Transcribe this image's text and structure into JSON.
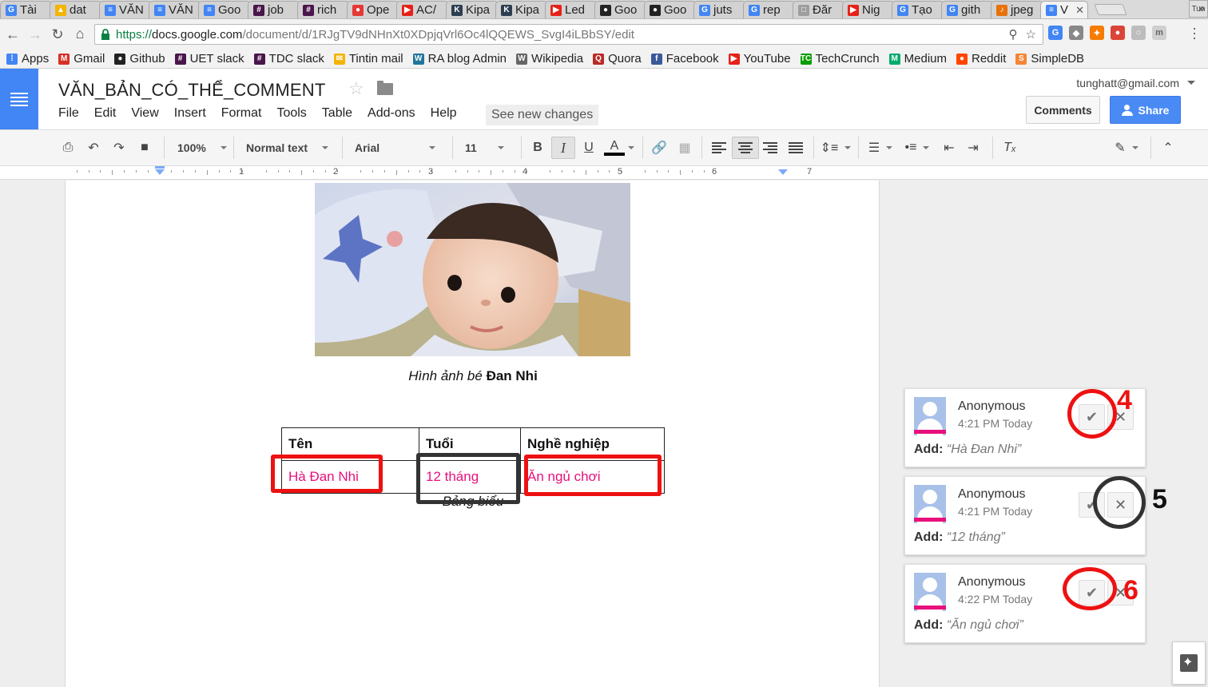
{
  "browser": {
    "tabs": [
      {
        "label": "Tài",
        "icon": "google-icon",
        "color": "#4285f4",
        "glyph": "G"
      },
      {
        "label": "dat",
        "icon": "drive-icon",
        "color": "#f4b400",
        "glyph": "▲"
      },
      {
        "label": "VĂN",
        "icon": "docs-icon",
        "color": "#4285f4",
        "glyph": "≡"
      },
      {
        "label": "VĂN",
        "icon": "docs-icon",
        "color": "#4285f4",
        "glyph": "≡"
      },
      {
        "label": "Goo",
        "icon": "docs-icon",
        "color": "#4285f4",
        "glyph": "≡"
      },
      {
        "label": "job",
        "icon": "slack-icon",
        "color": "#4a154b",
        "glyph": "#"
      },
      {
        "label": "rich",
        "icon": "slack-icon",
        "color": "#4a154b",
        "glyph": "#"
      },
      {
        "label": "Ope",
        "icon": "pokeball-icon",
        "color": "#e53935",
        "glyph": "●"
      },
      {
        "label": "AC/",
        "icon": "youtube-icon",
        "color": "#e62117",
        "glyph": "▶"
      },
      {
        "label": "Kipa",
        "icon": "kipalog-icon",
        "color": "#2c3e50",
        "glyph": "K"
      },
      {
        "label": "Kipa",
        "icon": "kipalog-icon",
        "color": "#2c3e50",
        "glyph": "K"
      },
      {
        "label": "Led",
        "icon": "youtube-icon",
        "color": "#e62117",
        "glyph": "▶"
      },
      {
        "label": "Goo",
        "icon": "github-icon",
        "color": "#222222",
        "glyph": "●"
      },
      {
        "label": "Goo",
        "icon": "github-icon",
        "color": "#222222",
        "glyph": "●"
      },
      {
        "label": "juts",
        "icon": "google-icon",
        "color": "#4285f4",
        "glyph": "G"
      },
      {
        "label": "rep",
        "icon": "google-icon",
        "color": "#4285f4",
        "glyph": "G"
      },
      {
        "label": "Đăr",
        "icon": "page-icon",
        "color": "#9e9e9e",
        "glyph": "□"
      },
      {
        "label": "Nig",
        "icon": "youtube-icon",
        "color": "#e62117",
        "glyph": "▶"
      },
      {
        "label": "Tạo",
        "icon": "google-icon",
        "color": "#4285f4",
        "glyph": "G"
      },
      {
        "label": "gith",
        "icon": "google-icon",
        "color": "#4285f4",
        "glyph": "G"
      },
      {
        "label": "jpeg",
        "icon": "extension-icon",
        "color": "#e8710a",
        "glyph": "♪"
      },
      {
        "label": "V",
        "icon": "docs-icon",
        "color": "#4285f4",
        "glyph": "≡",
        "active": true
      }
    ],
    "profile": "Tun",
    "url": {
      "scheme": "https://",
      "domain": "docs.google.com",
      "path": "/document/d/1RJgTV9dNHnXt0XDpjqVrl6Oc4lQQEWS_SvgI4iLBbSY/edit"
    },
    "bookmarks": [
      {
        "label": "Apps",
        "icon": "apps-grid-icon",
        "color": "#4285f4",
        "glyph": "⁞"
      },
      {
        "label": "Gmail",
        "icon": "gmail-icon",
        "color": "#d93025",
        "glyph": "M"
      },
      {
        "label": "Github",
        "icon": "github-icon",
        "color": "#222222",
        "glyph": "●"
      },
      {
        "label": "UET slack",
        "icon": "slack-icon",
        "color": "#4a154b",
        "glyph": "#"
      },
      {
        "label": "TDC slack",
        "icon": "slack-icon",
        "color": "#4a154b",
        "glyph": "#"
      },
      {
        "label": "Tintin mail",
        "icon": "mail-icon",
        "color": "#f4b400",
        "glyph": "✉"
      },
      {
        "label": "RA blog Admin",
        "icon": "wordpress-icon",
        "color": "#21759b",
        "glyph": "W"
      },
      {
        "label": "Wikipedia",
        "icon": "wikipedia-icon",
        "color": "#666666",
        "glyph": "W"
      },
      {
        "label": "Quora",
        "icon": "quora-icon",
        "color": "#b92b27",
        "glyph": "Q"
      },
      {
        "label": "Facebook",
        "icon": "facebook-icon",
        "color": "#3b5998",
        "glyph": "f"
      },
      {
        "label": "YouTube",
        "icon": "youtube-icon",
        "color": "#e62117",
        "glyph": "▶"
      },
      {
        "label": "TechCrunch",
        "icon": "techcrunch-icon",
        "color": "#0a9e01",
        "glyph": "TC"
      },
      {
        "label": "Medium",
        "icon": "medium-icon",
        "color": "#00ab6c",
        "glyph": "M"
      },
      {
        "label": "Reddit",
        "icon": "reddit-icon",
        "color": "#ff4500",
        "glyph": "●"
      },
      {
        "label": "SimpleDB",
        "icon": "simpledb-icon",
        "color": "#f58536",
        "glyph": "S"
      }
    ]
  },
  "docs": {
    "title": "VĂN_BẢN_CÓ_THỂ_COMMENT",
    "menu": [
      "File",
      "Edit",
      "View",
      "Insert",
      "Format",
      "Tools",
      "Table",
      "Add-ons",
      "Help"
    ],
    "see_changes": "See new changes",
    "user_email": "tunghatt@gmail.com",
    "comments_label": "Comments",
    "share_label": "Share",
    "toolbar": {
      "zoom": "100%",
      "style": "Normal text",
      "font": "Arial",
      "size": "11",
      "bold": "B",
      "italic": "I",
      "underline": "U",
      "text_color": "A"
    },
    "ruler_numbers": [
      "1",
      "2",
      "3",
      "4",
      "5",
      "6",
      "7"
    ],
    "document": {
      "caption_italic": "Hình ảnh bé",
      "caption_bold": "Đan Nhi",
      "table": {
        "headers": [
          "Tên",
          "Tuổi",
          "Nghề nghiệp"
        ],
        "row": [
          "Hà Đan Nhi",
          "12 tháng",
          "Ăn ngủ chơi"
        ]
      },
      "table_caption": "Bảng biểu"
    },
    "suggestions": [
      {
        "author": "Anonymous",
        "time": "4:21 PM Today",
        "action": "Add:",
        "text": "“Hà Đan Nhi”",
        "step": "4"
      },
      {
        "author": "Anonymous",
        "time": "4:21 PM Today",
        "action": "Add:",
        "text": "“12 tháng”",
        "step": "5"
      },
      {
        "author": "Anonymous",
        "time": "4:22 PM Today",
        "action": "Add:",
        "text": "“Ăn ngủ chơi”",
        "step": "6"
      }
    ]
  },
  "colors": {
    "docs_blue": "#4285f4",
    "suggestion_pink": "#e8107c",
    "annotation_red": "#ee1111",
    "annotation_dark": "#333333"
  }
}
